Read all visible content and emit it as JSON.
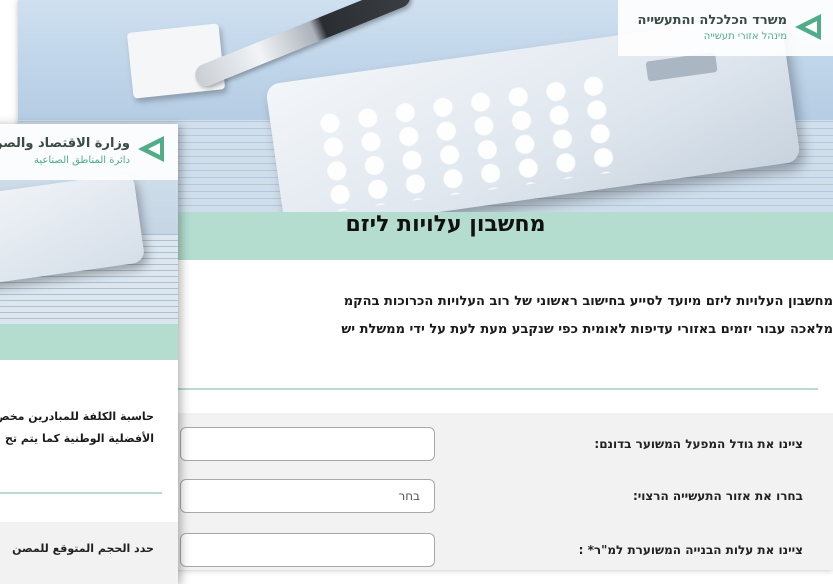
{
  "hebrew_window": {
    "logo": {
      "title": "משרד הכלכלה והתעשייה",
      "subtitle": "מינהל אזורי תעשייה"
    },
    "page_title": "מחשבון עלויות ליזם",
    "intro": {
      "line1": "מחשבון העלויות ליזם מיועד לסייע בחישוב ראשוני של רוב העלויות הכרוכות בהקמ",
      "line2": "מלאכה עבור יזמים באזורי עדיפות לאומית כפי שנקבע מעת לעת על ידי ממשלת יש"
    },
    "form": {
      "factory_size_label": "ציינו את גודל המפעל המשוער בדונם:",
      "factory_size_value": "",
      "zone_label": "בחרו את אזור התעשייה הרצוי:",
      "zone_selected": "בחר",
      "cost_label": "ציינו את עלות הבנייה המשוערת למ\"ר* :",
      "cost_value": ""
    }
  },
  "arabic_window": {
    "logo": {
      "title": "وزارة الاقتصاد والصن",
      "subtitle": "دائرة المناطق الصناعية"
    },
    "intro": {
      "line1": "حاسبة الكلفة للمبادرين مخص",
      "line2": "الأفضلية الوطنية كما يتم تح"
    },
    "form": {
      "factory_size_label": "حدد الحجم المتوقع للمصن"
    }
  },
  "colors": {
    "accent_band": "#b4ddd0",
    "logo_green": "#4fae87",
    "form_bg": "#f2f2f2"
  }
}
